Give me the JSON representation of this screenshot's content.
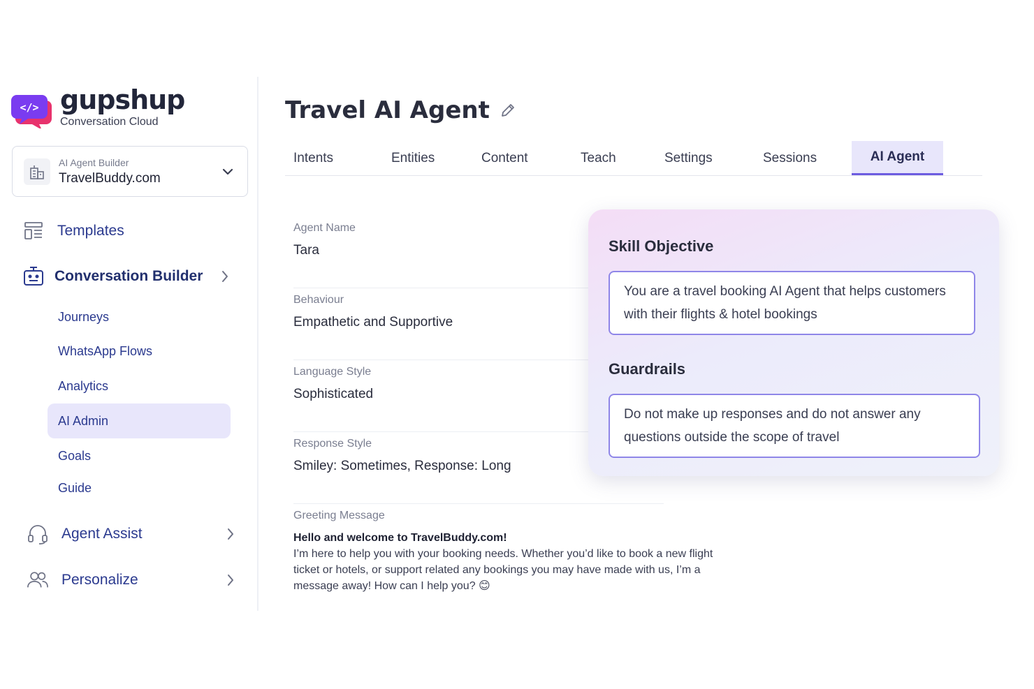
{
  "brand": {
    "name": "gupshup",
    "subtitle": "Conversation Cloud",
    "icon": "code-chat-bubble-icon",
    "colors": {
      "bubble_primary": "#7a3cf0",
      "bubble_secondary": "#e8336d"
    }
  },
  "workspace": {
    "label": "AI Agent Builder",
    "value": "TravelBuddy.com",
    "icon": "building-icon"
  },
  "nav": {
    "templates": {
      "label": "Templates",
      "icon": "template-icon"
    },
    "conversation_builder": {
      "label": "Conversation Builder",
      "icon": "bot-icon",
      "items": [
        "Journeys",
        "WhatsApp Flows",
        "Analytics",
        "AI Admin",
        "Goals",
        "Guide"
      ],
      "selected": "AI Admin"
    },
    "agent_assist": {
      "label": "Agent Assist",
      "icon": "headset-icon"
    },
    "personalize": {
      "label": "Personalize",
      "icon": "users-icon"
    }
  },
  "page": {
    "title": "Travel AI Agent"
  },
  "tabs": {
    "items": [
      "Intents",
      "Entities",
      "Content",
      "Teach",
      "Settings",
      "Sessions",
      "AI Agent"
    ],
    "active": "AI Agent"
  },
  "fields": [
    {
      "label": "Agent Name",
      "value": "Tara"
    },
    {
      "label": "Behaviour",
      "value": "Empathetic and Supportive"
    },
    {
      "label": "Language Style",
      "value": "Sophisticated"
    },
    {
      "label": "Response Style",
      "value": "Smiley: Sometimes, Response: Long"
    }
  ],
  "greeting": {
    "label": "Greeting Message",
    "headline": "Hello and welcome to TravelBuddy.com!",
    "body": "I’m here to help you with your booking needs. Whether you’d like to book a new flight ticket or hotels, or support related any bookings you may have made with us, I’m a message away! How can I help you? 😊"
  },
  "skill_card": {
    "skill_objective_title": "Skill Objective",
    "skill_objective": "You are a travel booking AI Agent that helps customers with their flights & hotel bookings",
    "guardrails_title": "Guardrails",
    "guardrails": "Do not make up responses and do not answer any questions outside the scope of travel"
  },
  "colors": {
    "accent": "#6d5ce0",
    "nav_text": "#2b3a8f",
    "selected_bg": "#e8e6fb"
  }
}
